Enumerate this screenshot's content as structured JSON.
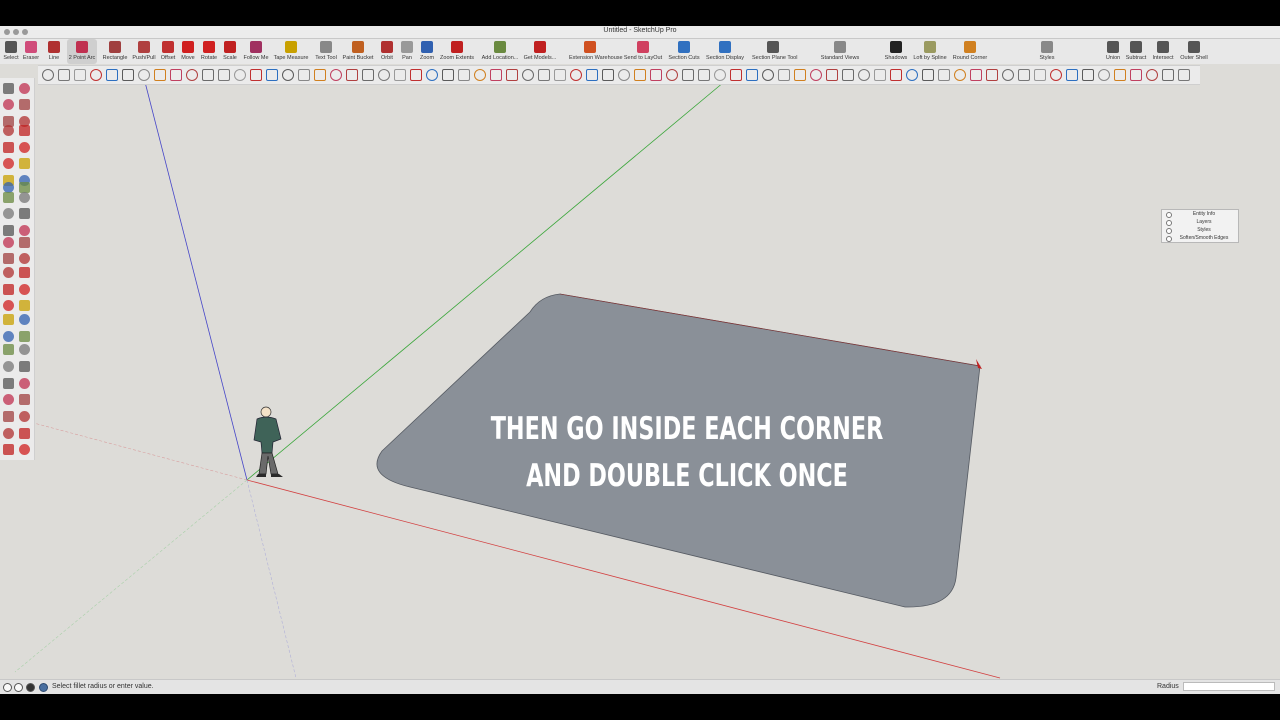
{
  "window": {
    "title": "Untitled - SketchUp Pro"
  },
  "toolbar": {
    "items": [
      {
        "label": "Select",
        "icon": "select-arrow-icon",
        "color": "#555555"
      },
      {
        "label": "Eraser",
        "icon": "eraser-icon",
        "color": "#d04c7a"
      },
      {
        "label": "Line",
        "icon": "pencil-icon",
        "color": "#b03030"
      },
      {
        "label": "2 Point Arc",
        "icon": "arc-icon",
        "color": "#c03050",
        "selected": true
      },
      {
        "label": "Rectangle",
        "icon": "rectangle-icon",
        "color": "#a04040"
      },
      {
        "label": "Push/Pull",
        "icon": "push-pull-icon",
        "color": "#b04040"
      },
      {
        "label": "Offset",
        "icon": "offset-icon",
        "color": "#c03030"
      },
      {
        "label": "Move",
        "icon": "move-icon",
        "color": "#d02020"
      },
      {
        "label": "Rotate",
        "icon": "rotate-icon",
        "color": "#d02020"
      },
      {
        "label": "Scale",
        "icon": "scale-icon",
        "color": "#c02020"
      },
      {
        "label": "Follow Me",
        "icon": "follow-me-icon",
        "color": "#a03060"
      },
      {
        "label": "Tape Measure",
        "icon": "tape-measure-icon",
        "color": "#c8a000"
      },
      {
        "label": "Text Tool",
        "icon": "text-icon",
        "color": "#888888"
      },
      {
        "label": "Paint Bucket",
        "icon": "paint-bucket-icon",
        "color": "#c06020"
      },
      {
        "label": "Orbit",
        "icon": "orbit-icon",
        "color": "#b03030"
      },
      {
        "label": "Pan",
        "icon": "pan-icon",
        "color": "#999999"
      },
      {
        "label": "Zoom",
        "icon": "zoom-icon",
        "color": "#3060b0"
      },
      {
        "label": "Zoom Extents",
        "icon": "zoom-extents-icon",
        "color": "#c02020"
      },
      {
        "label": "Add Location...",
        "icon": "add-location-icon",
        "color": "#6a8a40"
      },
      {
        "label": "Get Models...",
        "icon": "get-models-icon",
        "color": "#c02020"
      },
      {
        "label": "Extension Warehouse",
        "icon": "extension-warehouse-icon",
        "color": "#d05020"
      },
      {
        "label": "Send to LayOut",
        "icon": "send-to-layout-icon",
        "color": "#d04060"
      },
      {
        "label": "Section Cuts",
        "icon": "section-cuts-icon",
        "color": "#3070c0"
      },
      {
        "label": "Section Display",
        "icon": "section-display-icon",
        "color": "#3070c0"
      },
      {
        "label": "Section Plane Tool",
        "icon": "section-plane-icon",
        "color": "#555555"
      },
      {
        "label": "Standard Views",
        "icon": "standard-views-icon",
        "color": "#888888"
      },
      {
        "label": "Shadows",
        "icon": "shadows-icon",
        "color": "#222222"
      },
      {
        "label": "Loft by Spline",
        "icon": "loft-icon",
        "color": "#9a9a60"
      },
      {
        "label": "Round Corner",
        "icon": "round-corner-icon",
        "color": "#d08020"
      },
      {
        "label": "Styles",
        "icon": "styles-icon",
        "color": "#888888"
      },
      {
        "label": "Union",
        "icon": "union-icon",
        "color": "#555555"
      },
      {
        "label": "Subtract",
        "icon": "subtract-icon",
        "color": "#555555"
      },
      {
        "label": "Intersect",
        "icon": "intersect-icon",
        "color": "#555555"
      },
      {
        "label": "Outer Shell",
        "icon": "outer-shell-icon",
        "color": "#555555"
      }
    ]
  },
  "viewport": {
    "axis_colors": {
      "red": "#d24040",
      "green": "#3aa63a",
      "blue": "#4646c8"
    },
    "face_color": "#8a9098",
    "background": "#dddcd8",
    "caption_lines": [
      "THEN GO INSIDE EACH CORNER",
      "AND DOUBLE CLICK ONCE"
    ]
  },
  "tray": {
    "items": [
      "Entity Info",
      "Layers",
      "Styles",
      "Soften/Smooth Edges"
    ]
  },
  "statusbar": {
    "message": "Select fillet radius or enter value.",
    "vcb_label": "Radius",
    "vcb_value": ""
  }
}
